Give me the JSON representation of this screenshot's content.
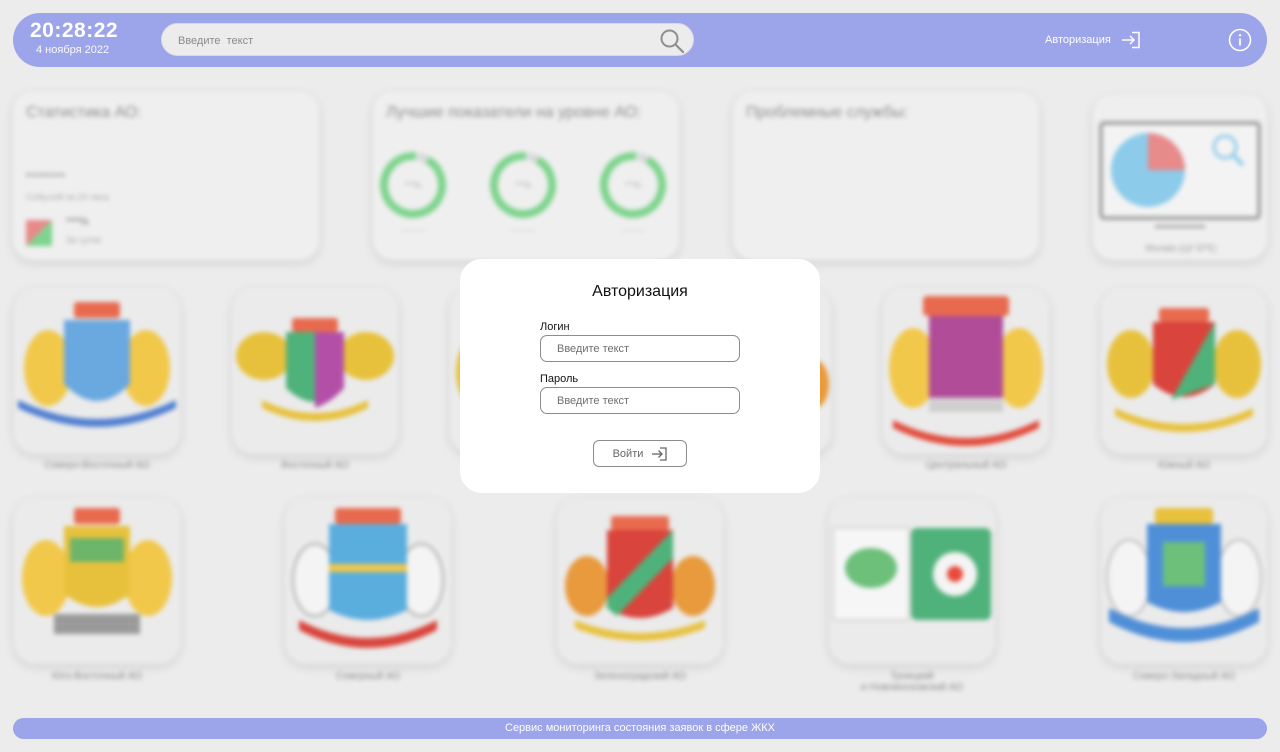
{
  "header": {
    "time": "20:28:22",
    "date": "4 ноября 2022",
    "search_placeholder": "Введите  текст",
    "auth_label": "Авторизация"
  },
  "dashboard": {
    "stats_title": "Статистика АО:",
    "stats_value": "*******",
    "stats_sub": "Событий за 24 часа",
    "stats_percent": "***%",
    "stats_period": "За сутки",
    "best_title": "Лучшие показатели на уровне АО:",
    "best_items": [
      {
        "value": "***%",
        "label": "———"
      },
      {
        "value": "***%",
        "label": "———"
      },
      {
        "value": "***%",
        "label": "———"
      }
    ],
    "problem_title": "Проблемные службы:",
    "pie_caption": "Москва (ЦУ ЕГЕ)",
    "districts": [
      {
        "name": "Северо-Восточный АО"
      },
      {
        "name": "Восточный АО"
      },
      {
        "name": "Центральный АО"
      },
      {
        "name": "Южный АО"
      },
      {
        "name": "Юго-Восточный АО"
      },
      {
        "name": "Северный АО"
      },
      {
        "name": "Зеленоградский АО"
      },
      {
        "name": "Троицкий\nи Новомосковский АО"
      },
      {
        "name": "Северо-Западный АО"
      }
    ]
  },
  "footer": {
    "text": "Сервис мониторинга состояния заявок в сфере ЖКХ"
  },
  "modal": {
    "title": "Авторизация",
    "login_label": "Логин",
    "login_placeholder": "Введите текст",
    "password_label": "Пароль",
    "password_placeholder": "Введите текст",
    "submit_label": "Войти"
  },
  "colors": {
    "accent": "#9ca4ea",
    "background": "#ececec",
    "ring_green": "#7ed48e",
    "pie_blue": "#8ccbea",
    "pie_red": "#e88a8a"
  }
}
